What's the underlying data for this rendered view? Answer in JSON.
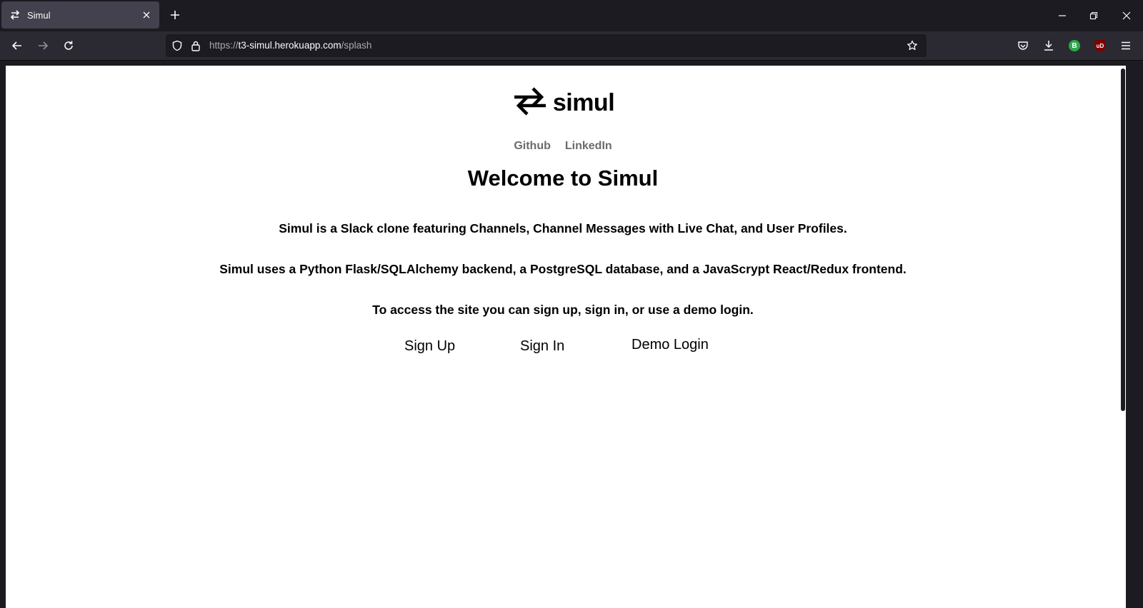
{
  "browser": {
    "tab_title": "Simul",
    "url_prefix": "https://",
    "url_host": "t3-simul.herokuapp.com",
    "url_path": "/splash",
    "extension_b_label": "B",
    "extension_ublock_label": "uD"
  },
  "page": {
    "logo_text": "simul",
    "links": [
      "Github",
      "LinkedIn"
    ],
    "heading": "Welcome to Simul",
    "paragraphs": [
      "Simul is a Slack clone featuring Channels, Channel Messages with Live Chat, and User Profiles.",
      "Simul uses a Python Flask/SQLAlchemy backend, a PostgreSQL database, and a JavaScrypt React/Redux frontend.",
      "To access the site you can sign up, sign in, or use a demo login."
    ],
    "buttons": {
      "sign_up": "Sign Up",
      "sign_in": "Sign In",
      "demo_login": "Demo Login"
    }
  },
  "colors": {
    "chrome_dark": "#1c1b22",
    "chrome_toolbar": "#2b2a33",
    "tab_active": "#42414d",
    "link_gray": "#6b6b6b"
  }
}
